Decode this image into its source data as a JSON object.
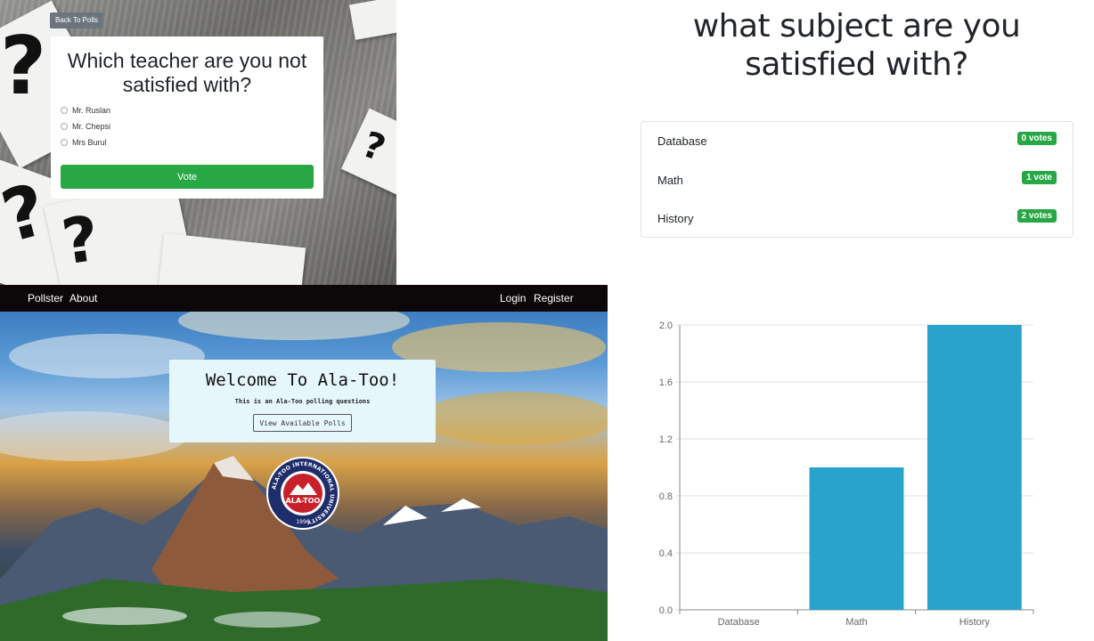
{
  "vote_page": {
    "back_label": "Back To Polls",
    "question": "Which teacher are you not satisfied with?",
    "options": [
      "Mr. Ruslan",
      "Mr. Chepsi",
      "Mrs Burul"
    ],
    "vote_label": "Vote"
  },
  "results_page": {
    "title": "what subject are you satisfied with?",
    "rows": [
      {
        "label": "Database",
        "badge": "0 votes"
      },
      {
        "label": "Math",
        "badge": "1 vote"
      },
      {
        "label": "History",
        "badge": "2 votes"
      }
    ],
    "badge_color": "#28a745"
  },
  "home_page": {
    "nav": {
      "brand": "Pollster",
      "about": "About",
      "login": "Login",
      "register": "Register"
    },
    "welcome_title": "Welcome To Ala-Too!",
    "welcome_sub": "This is an Ala-Too polling questions",
    "view_polls_label": "View Available Polls",
    "seal": {
      "ring_text": "ALA-TOO INTERNATIONAL UNIVERSITY",
      "name": "ALA-TOO",
      "year": "1996"
    }
  },
  "chart_data": {
    "type": "bar",
    "categories": [
      "Database",
      "Math",
      "History"
    ],
    "values": [
      0,
      1,
      2
    ],
    "ylim": [
      0,
      2
    ],
    "yticks": [
      "0.0",
      "0.4",
      "0.8",
      "1.2",
      "1.6",
      "2.0"
    ],
    "grid": true,
    "bar_color": "#2aa3cc"
  }
}
